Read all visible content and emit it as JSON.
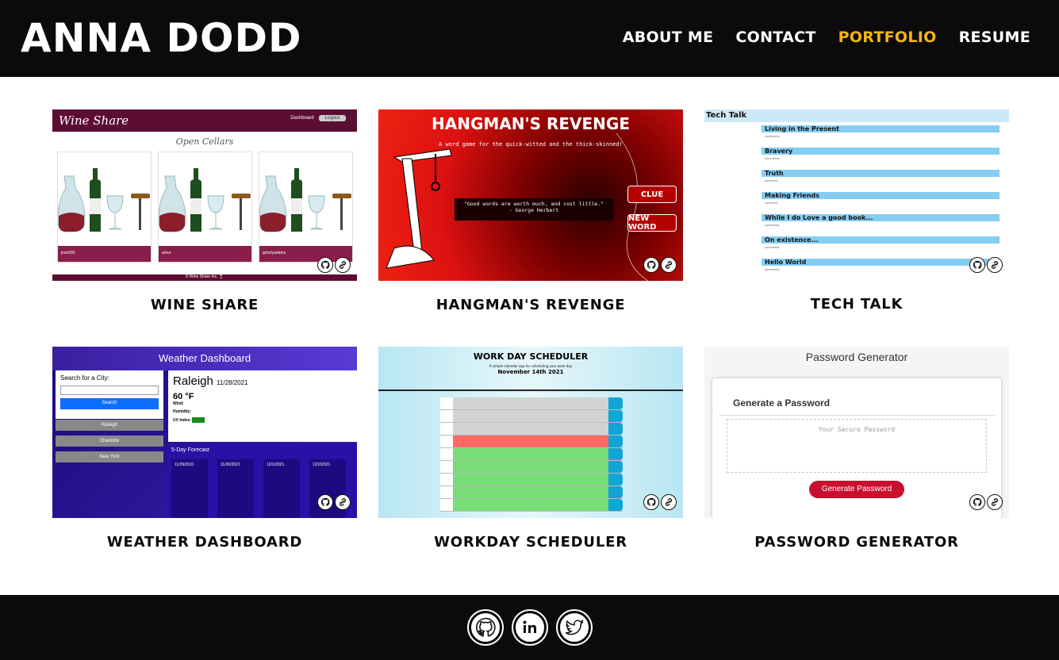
{
  "header": {
    "brand": "ANNA DODD",
    "nav": [
      "ABOUT ME",
      "CONTACT",
      "PORTFOLIO",
      "RESUME"
    ],
    "active": "PORTFOLIO",
    "active_color": "#f5b60c"
  },
  "projects": [
    {
      "title": "WINE SHARE",
      "thumb": {
        "app_name": "Wine Share",
        "nav_dashboard": "Dashboard",
        "nav_logout": "Logout",
        "subtitle": "Open Cellars",
        "cellars": [
          "jose090",
          "anna",
          "grizzlyadams"
        ],
        "footer": "© Wine Share Inc. 🍷"
      }
    },
    {
      "title": "HANGMAN'S REVENGE",
      "thumb": {
        "game_title": "HANGMAN'S REVENGE",
        "tagline": "A word game for the quick-witted and the thick-skinned!",
        "quote": "\"Good words are worth much, and cost little.\"",
        "quote_author": "- George Herbert",
        "clue_button": "CLUE",
        "new_word_button": "NEW WORD"
      }
    },
    {
      "title": "TECH TALK",
      "thumb": {
        "blog_name": "Tech Talk",
        "posts": [
          "Living in the Present",
          "Bravery",
          "Truth",
          "Making Friends",
          "While I do Love a good book...",
          "On existence...",
          "Hello World"
        ]
      }
    },
    {
      "title": "WEATHER DASHBOARD",
      "thumb": {
        "app_title": "Weather Dashboard",
        "search_label": "Search for a City:",
        "search_button": "Search",
        "history": [
          "Raleigh",
          "Charlotte",
          "New York"
        ],
        "city": "Raleigh",
        "date": "11/28/2021",
        "temp": "60 °F",
        "wind_label": "Wind:",
        "humidity_label": "Humidity:",
        "uv_label": "UV Index:",
        "forecast_title": "5-Day Forecast",
        "forecast_dates": [
          "11/29/2021",
          "11/30/2021",
          "12/1/2021",
          "12/2/2021"
        ]
      }
    },
    {
      "title": "WORKDAY SCHEDULER",
      "thumb": {
        "app_title": "WORK DAY SCHEDULER",
        "subtitle": "A simple calendar app for scheduling your work day",
        "date": "November 14th 2021"
      }
    },
    {
      "title": "PASSWORD GENERATOR",
      "thumb": {
        "app_title": "Password Generator",
        "card_heading": "Generate a Password",
        "placeholder": "Your Secure Password",
        "button": "Generate Password"
      }
    }
  ],
  "icons": {
    "repo": "github-icon",
    "link": "link-icon"
  },
  "footer": {
    "social": [
      "github-icon",
      "linkedin-icon",
      "twitter-icon"
    ]
  }
}
